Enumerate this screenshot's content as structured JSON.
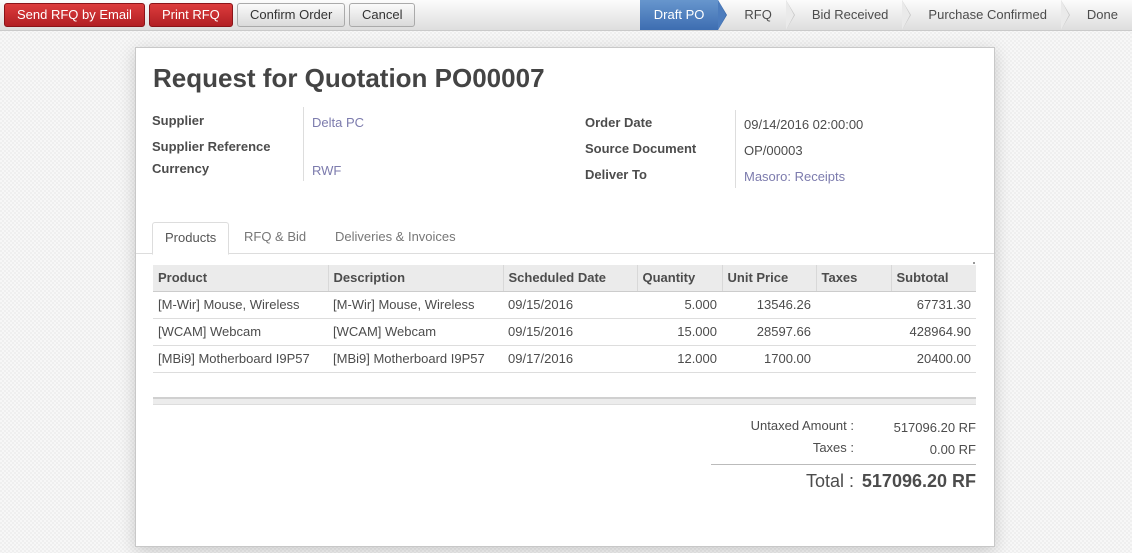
{
  "toolbar": {
    "buttons": [
      {
        "label": "Send RFQ by Email",
        "style": "primary"
      },
      {
        "label": "Print RFQ",
        "style": "primary"
      },
      {
        "label": "Confirm Order",
        "style": "default"
      },
      {
        "label": "Cancel",
        "style": "default"
      }
    ]
  },
  "stages": [
    {
      "label": "Draft PO",
      "active": true
    },
    {
      "label": "RFQ",
      "active": false
    },
    {
      "label": "Bid Received",
      "active": false
    },
    {
      "label": "Purchase Confirmed",
      "active": false
    },
    {
      "label": "Done",
      "active": false
    }
  ],
  "form": {
    "title": "Request for Quotation PO00007",
    "left_fields": [
      {
        "label": "Supplier",
        "value": "Delta PC"
      },
      {
        "label": "Supplier Reference",
        "value": ""
      },
      {
        "label": "Currency",
        "value": "RWF"
      }
    ],
    "right_fields": [
      {
        "label": "Order Date",
        "value": "09/14/2016 02:00:00"
      },
      {
        "label": "Source Document",
        "value": "OP/00003"
      },
      {
        "label": "Deliver To",
        "value": "Masoro: Receipts"
      }
    ],
    "link_color": "#7c7bad"
  },
  "tabs": [
    {
      "label": "Products",
      "active": true
    },
    {
      "label": "RFQ & Bid",
      "active": false
    },
    {
      "label": "Deliveries & Invoices",
      "active": false
    }
  ],
  "table": {
    "columns": [
      "Product",
      "Description",
      "Scheduled Date",
      "Quantity",
      "Unit Price",
      "Taxes",
      "Subtotal"
    ],
    "rows": [
      [
        "[M-Wir] Mouse, Wireless",
        "[M-Wir] Mouse, Wireless",
        "09/15/2016",
        "5.000",
        "13546.26",
        "",
        "67731.30"
      ],
      [
        "[WCAM] Webcam",
        "[WCAM] Webcam",
        "09/15/2016",
        "15.000",
        "28597.66",
        "",
        "428964.90"
      ],
      [
        "[MBi9] Motherboard I9P57",
        "[MBi9] Motherboard I9P57",
        "09/17/2016",
        "12.000",
        "1700.00",
        "",
        "20400.00"
      ]
    ]
  },
  "totals": {
    "untaxed_label": "Untaxed Amount :",
    "untaxed_value": "517096.20 RF",
    "taxes_label": "Taxes :",
    "taxes_value": "0.00 RF",
    "total_label": "Total :",
    "total_value": "517096.20 RF"
  },
  "colors": {
    "primary_button": "#b21f24",
    "active_stage": "#3d6db1"
  }
}
